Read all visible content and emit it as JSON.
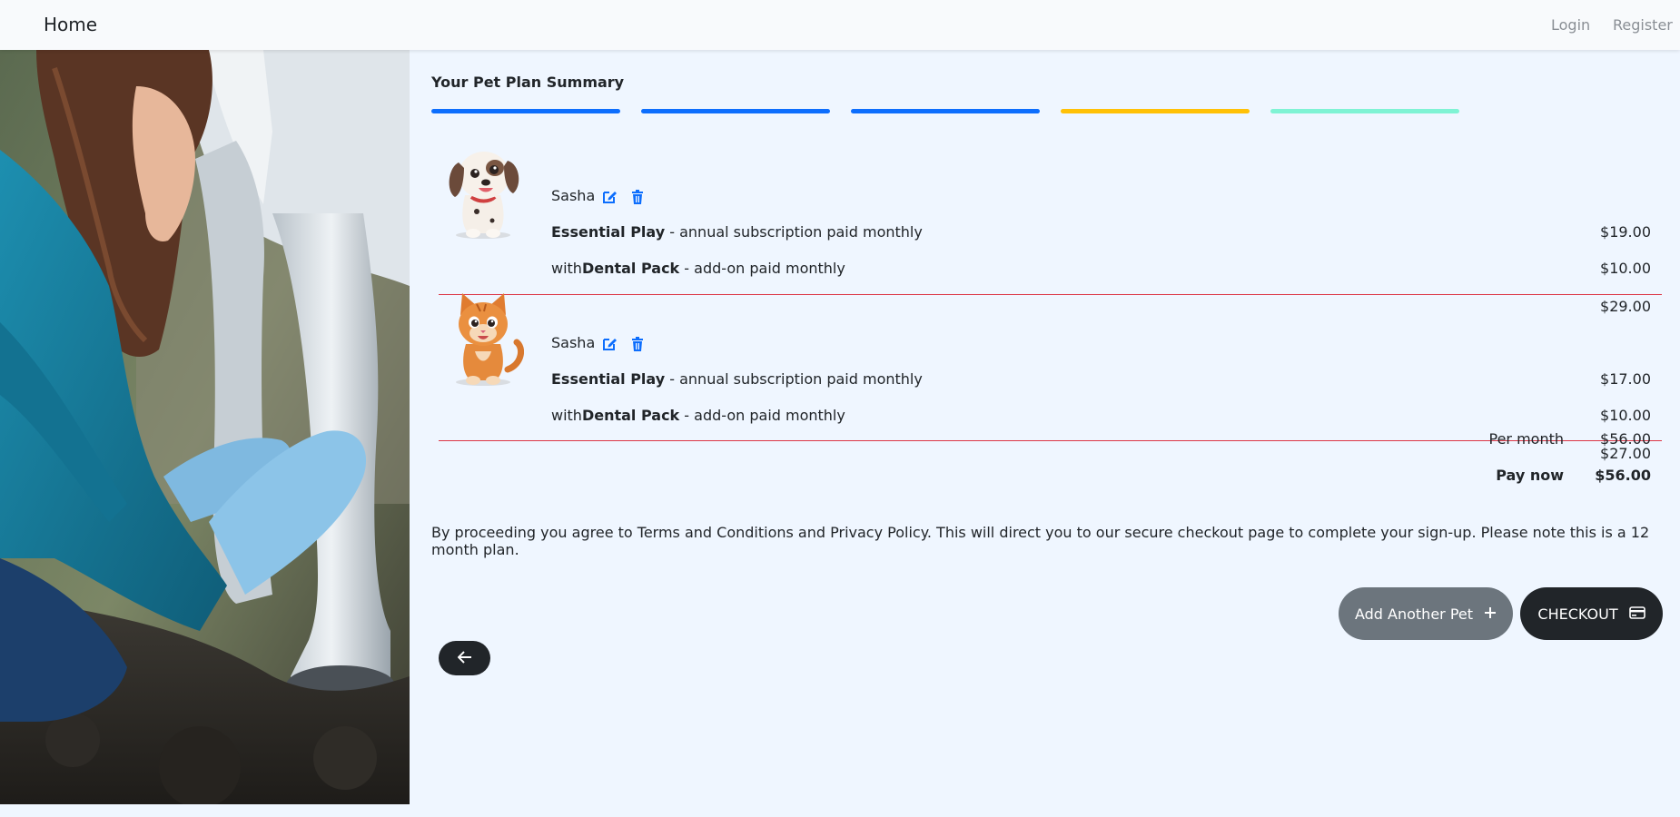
{
  "nav": {
    "brand": "Home",
    "login": "Login",
    "register": "Register"
  },
  "summary": {
    "title": "Your Pet Plan Summary",
    "steps": [
      {
        "color": "#0d6efd"
      },
      {
        "color": "#0d6efd"
      },
      {
        "color": "#0d6efd"
      },
      {
        "color": "#ffc107"
      },
      {
        "color": "#7ff3d4"
      }
    ]
  },
  "pets": [
    {
      "name": "Sasha",
      "image": "puppy",
      "plan_name": "Essential Play",
      "plan_desc": " - annual subscription paid monthly",
      "plan_price": "$19.00",
      "addon_prefix": "with",
      "addon_name": "Dental Pack",
      "addon_desc": " - add-on paid monthly",
      "addon_price": "$10.00",
      "subtotal": "$29.00"
    },
    {
      "name": "Sasha",
      "image": "kitten",
      "plan_name": "Essential Play",
      "plan_desc": " - annual subscription paid monthly",
      "plan_price": "$17.00",
      "addon_prefix": "with",
      "addon_name": "Dental Pack",
      "addon_desc": " - add-on paid monthly",
      "addon_price": "$10.00",
      "subtotal": "$27.00"
    }
  ],
  "totals": {
    "per_month_label": "Per month",
    "per_month_value": "$56.00",
    "pay_now_label": "Pay now",
    "pay_now_value": "$56.00"
  },
  "disclaimer": "By proceeding you agree to Terms and Conditions and Privacy Policy. This will direct you to our secure checkout page to complete your sign-up. Please note this is a 12 month plan.",
  "buttons": {
    "add_pet": "Add Another Pet",
    "checkout": "CHECKOUT"
  },
  "icons": {
    "edit": "edit-icon",
    "delete": "trash-icon",
    "add": "plus-icon",
    "card": "credit-card-icon",
    "back": "arrow-left-icon",
    "accent": "#0d6efd"
  }
}
